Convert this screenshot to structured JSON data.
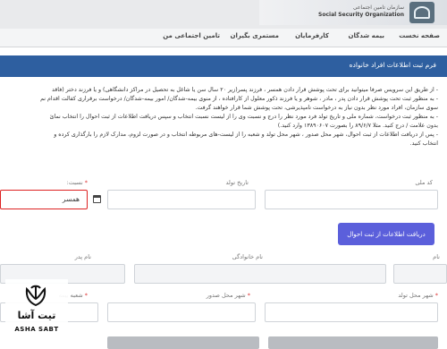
{
  "header": {
    "org_name_fa": "سازمان تامین اجتماعی",
    "org_name_en": "Social Security Organization"
  },
  "nav": {
    "items": [
      {
        "label": "صفحه نخست"
      },
      {
        "label": "بیمه شدگان"
      },
      {
        "label": "کارفرمایان"
      },
      {
        "label": "مستمری بگیران"
      },
      {
        "label": "تامین اجتماعی من"
      }
    ]
  },
  "form": {
    "title": "فرم ثبت اطلاعات افراد خانواده",
    "instructions": [
      "- از طریق این سرویس صرفا میتوانید برای تحت پوشش قرار دادن همسر ، فرزند پسر(زیر ۲۰ سال سن یا شاغل به تحصیل در مراکز دانشگاهی) و یا فرزند دختر (فاقد",
      "- به منظور ثبت تحت پوشش قرار دادن پدر ، مادر ، شوهر و یا فرزند ذکور معلول از کارافتاده ، از منوی بیمه-شدگان/ امور بیمه-شدگان/ درخواست برقراری کفالت اقدام نم",
      "سوی سازمان، افراد مورد نظر بدون نیاز به درخواست نامپذیرشی، تحت پوشش شما قرار خواهند گرفت.",
      "- به منظور ثبت درخواست، شماره ملی و تاریخ تولد فرد مورد نظر را درج و نسبت وی را از لیست نسبت انتخاب و سپس دریافت اطلاعات از ثبت احوال را انتخاب نمائ",
      "بدون علامت / درج کنید. مثلا ۸۹/۶/۷ را بصورت ۱۳۸۹۰۶۰۷ وارد کنید.)",
      "- پس از دریافت اطلاعات از ثبت احوال، شهر محل صدور ، شهر محل تولد و شعبه را از لیست-های مربوطه انتخاب و در صورت لزوم، مدارک لازم را بارگذاری کرده و",
      "انتخاب کنید."
    ],
    "national_code_label": "کد ملی",
    "birth_date_label": "تاریخ تولد",
    "relation_label": "نسبت:",
    "relation_value": "همسر",
    "fetch_button": "دریافت اطلاعات از ثبت احوال",
    "first_name_label": "نام",
    "last_name_label": "نام خانوادگی",
    "father_name_label": "نام پدر",
    "birth_city_label": "شهر محل تولد",
    "issue_city_label": "شهر محل صدور",
    "branch_label": "شعبه بیمه"
  },
  "watermark": {
    "name_fa": "تیت آشا",
    "name_en": "ASHA SABT"
  },
  "colors": {
    "title_bar": "#2e5fa0",
    "primary_button": "#5b5fdb",
    "required": "#d22222"
  }
}
